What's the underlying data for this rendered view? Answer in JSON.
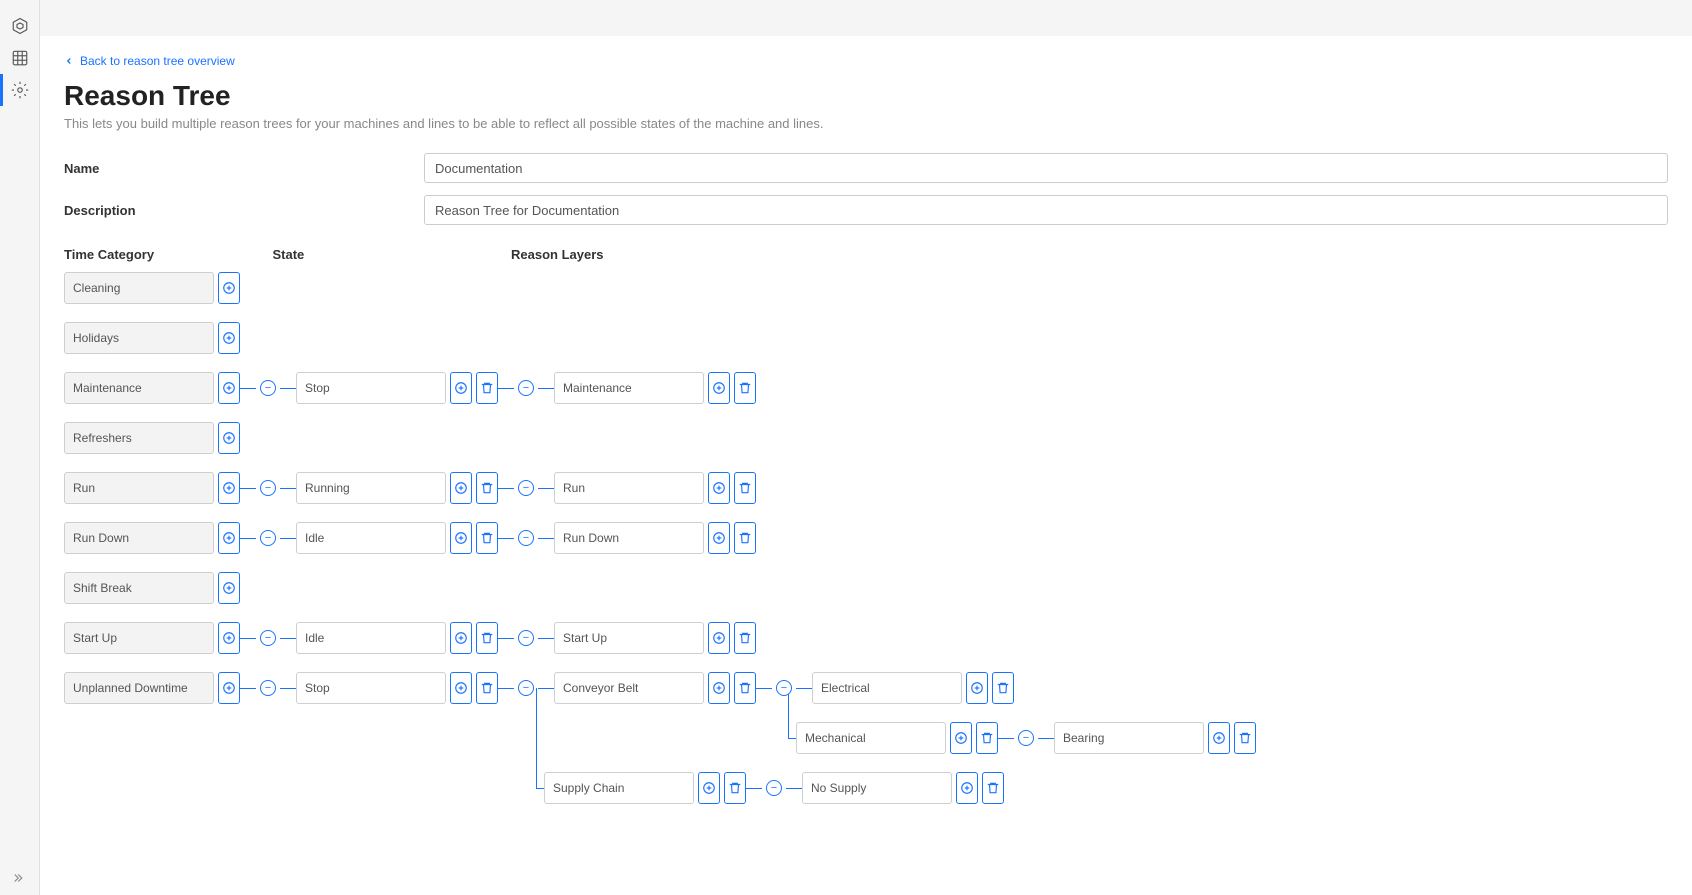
{
  "back_link": "Back to reason tree overview",
  "page_title": "Reason Tree",
  "subtitle": "This lets you build multiple reason trees for your machines and lines to be able to reflect all possible states of the machine and lines.",
  "form": {
    "name_label": "Name",
    "name_value": "Documentation",
    "desc_label": "Description",
    "desc_value": "Reason Tree for Documentation"
  },
  "headers": {
    "time_category": "Time Category",
    "state": "State",
    "reason_layers": "Reason Layers"
  },
  "rows": {
    "cleaning": "Cleaning",
    "holidays": "Holidays",
    "maintenance": "Maintenance",
    "maintenance_state": "Stop",
    "maintenance_reason": "Maintenance",
    "refreshers": "Refreshers",
    "run": "Run",
    "run_state": "Running",
    "run_reason": "Run",
    "run_down": "Run Down",
    "run_down_state": "Idle",
    "run_down_reason": "Run Down",
    "shift_break": "Shift Break",
    "start_up": "Start Up",
    "start_up_state": "Idle",
    "start_up_reason": "Start Up",
    "unplanned": "Unplanned Downtime",
    "unplanned_state": "Stop",
    "unplanned_r1": "Conveyor Belt",
    "unplanned_r1a": "Electrical",
    "unplanned_r1b": "Mechanical",
    "unplanned_r1b1": "Bearing",
    "unplanned_r2": "Supply Chain",
    "unplanned_r2a": "No Supply"
  }
}
